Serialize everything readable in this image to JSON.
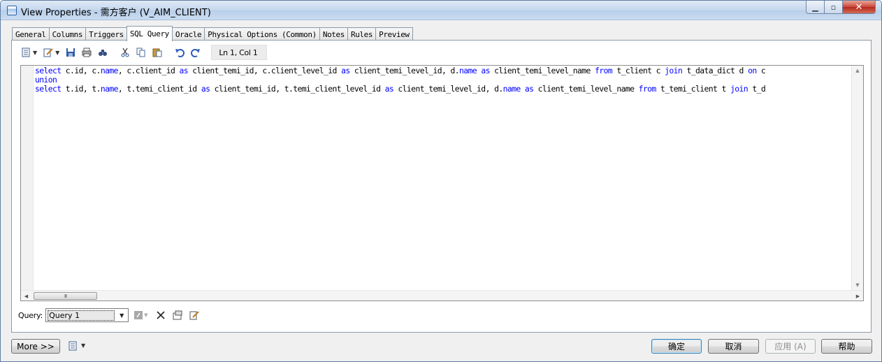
{
  "window": {
    "title": "View Properties - 需方客户 (V_AIM_CLIENT)",
    "minimize": "▁",
    "maximize": "▫",
    "close": "✕"
  },
  "tabs": [
    {
      "label": "General"
    },
    {
      "label": "Columns"
    },
    {
      "label": "Triggers"
    },
    {
      "label": "SQL Query",
      "active": true
    },
    {
      "label": "Oracle"
    },
    {
      "label": "Physical Options (Common)"
    },
    {
      "label": "Notes"
    },
    {
      "label": "Rules"
    },
    {
      "label": "Preview"
    }
  ],
  "toolbar": {
    "icons": [
      "properties-icon",
      "edit-icon",
      "save-icon",
      "print-icon",
      "find-icon",
      "cut-icon",
      "copy-icon",
      "paste-icon",
      "undo-icon",
      "redo-icon"
    ],
    "position": "Ln 1, Col 1"
  },
  "editor": {
    "lines": [
      [
        [
          "select",
          "kw"
        ],
        [
          " c.id, c.",
          ""
        ],
        [
          "name",
          "kw"
        ],
        [
          ", c.client_id ",
          ""
        ],
        [
          "as",
          "kw"
        ],
        [
          " client_temi_id, c.client_level_id ",
          ""
        ],
        [
          "as",
          "kw"
        ],
        [
          " client_temi_level_id, d.",
          ""
        ],
        [
          "name",
          "kw"
        ],
        [
          " ",
          ""
        ],
        [
          "as",
          "kw"
        ],
        [
          " client_temi_level_name ",
          ""
        ],
        [
          "from",
          "kw"
        ],
        [
          " t_client c ",
          ""
        ],
        [
          "join",
          "kw"
        ],
        [
          " t_data_dict d ",
          ""
        ],
        [
          "on",
          "kw"
        ],
        [
          " c",
          ""
        ]
      ],
      [
        [
          "union",
          "kw"
        ]
      ],
      [
        [
          "select",
          "kw"
        ],
        [
          " t.id, t.",
          ""
        ],
        [
          "name",
          "kw"
        ],
        [
          ", t.temi_client_id ",
          ""
        ],
        [
          "as",
          "kw"
        ],
        [
          " client_temi_id, t.temi_client_level_id ",
          ""
        ],
        [
          "as",
          "kw"
        ],
        [
          " client_temi_level_id, d.",
          ""
        ],
        [
          "name",
          "kw"
        ],
        [
          " ",
          ""
        ],
        [
          "as",
          "kw"
        ],
        [
          " client_temi_level_name ",
          ""
        ],
        [
          "from",
          "kw"
        ],
        [
          " t_temi_client t ",
          ""
        ],
        [
          "join",
          "kw"
        ],
        [
          " t_d",
          ""
        ]
      ]
    ],
    "colors": {
      "keyword": "#0000ff",
      "text": "#000000"
    },
    "hthumb_grip": "III"
  },
  "query": {
    "label": "Query:",
    "selected": "Query 1"
  },
  "buttons": {
    "more": "More >>",
    "ok": "确定",
    "cancel": "取消",
    "apply": "应用 (A)",
    "help": "帮助"
  }
}
